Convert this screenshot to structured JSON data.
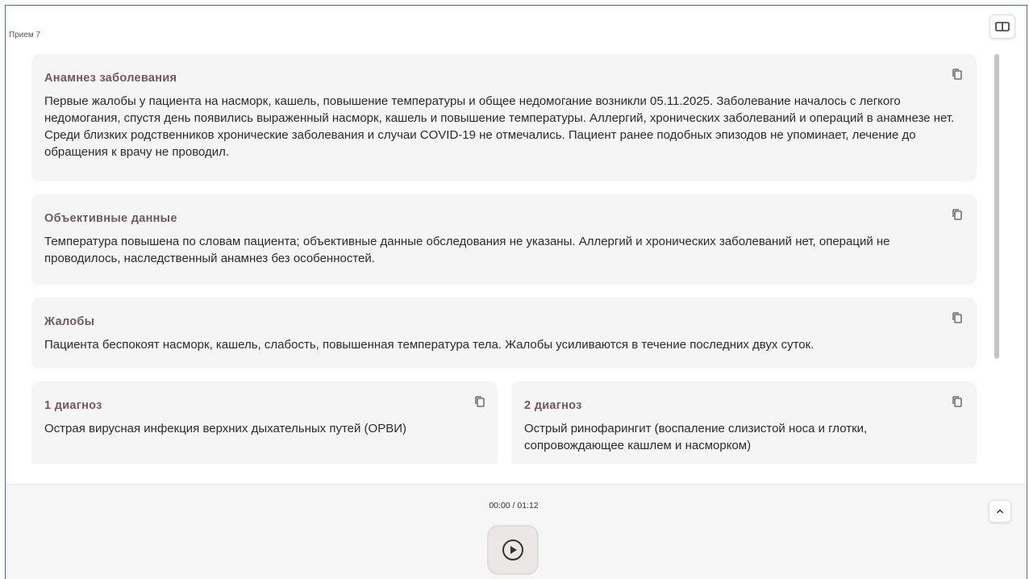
{
  "visit": {
    "title": "Прием 7"
  },
  "sections": [
    {
      "title": "Анамнез заболевания",
      "text": "Первые жалобы у пациента на насморк, кашель, повышение температуры и общее недомогание возникли 05.11.2025. Заболевание началось с легкого недомогания, спустя день появились выраженный насморк, кашель и повышение температуры. Аллергий, хронических заболеваний и операций в анамнезе нет. Среди близких родственников хронические заболевания и случаи COVID-19 не отмечались. Пациент ранее подобных эпизодов не упоминает, лечение до обращения к врачу не проводил."
    },
    {
      "title": "Объективные данные",
      "text": "Температура повышена по словам пациента; объективные данные обследования не указаны. Аллергий и хронических заболеваний нет, операций не проводилось, наследственный анамнез без особенностей."
    },
    {
      "title": "Жалобы",
      "text": "Пациента беспокоят насморк, кашель, слабость, повышенная температура тела. Жалобы усиливаются в течение последних двух суток."
    }
  ],
  "diagnoses": [
    {
      "title": "1 диагноз",
      "text": "Острая вирусная инфекция верхних дыхательных путей (ОРВИ)"
    },
    {
      "title": "2 диагноз",
      "text": "Острый ринофарингит (воспаление слизистой носа и глотки, сопровождающее кашлем и насморком)"
    }
  ],
  "player": {
    "time": "00:00 / 01:12"
  },
  "icons": {
    "copy": "copy-icon",
    "panel": "panel-toggle-icon",
    "play": "play-icon",
    "collapse": "chevron-up-icon"
  },
  "colors": {
    "card_bg": "#f6f5f5",
    "title": "#6e5a63",
    "window_border": "#4a6fa5"
  }
}
